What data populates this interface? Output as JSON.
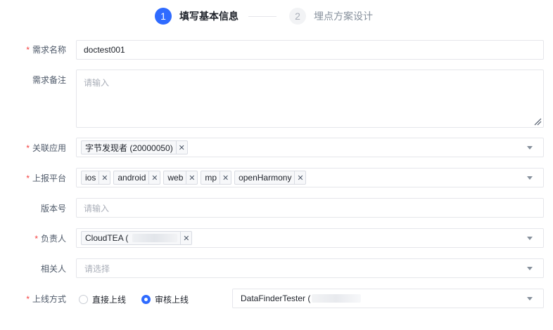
{
  "steps": [
    {
      "number": "1",
      "title": "填写基本信息",
      "state": "active"
    },
    {
      "number": "2",
      "title": "埋点方案设计",
      "state": "inactive"
    }
  ],
  "form": {
    "demand_name": {
      "label": "需求名称",
      "required": true,
      "value": "doctest001"
    },
    "demand_note": {
      "label": "需求备注",
      "required": false,
      "placeholder": "请输入"
    },
    "related_app": {
      "label": "关联应用",
      "required": true,
      "tags": [
        "字节发现者 (20000050)"
      ]
    },
    "platform": {
      "label": "上报平台",
      "required": true,
      "tags": [
        "ios",
        "android",
        "web",
        "mp",
        "openHarmony"
      ]
    },
    "version": {
      "label": "版本号",
      "required": false,
      "placeholder": "请输入"
    },
    "owner": {
      "label": "负责人",
      "required": true,
      "tags": [
        "CloudTEA ("
      ]
    },
    "related_people": {
      "label": "相关人",
      "required": false,
      "placeholder": "请选择"
    },
    "launch_method": {
      "label": "上线方式",
      "required": true,
      "options": [
        {
          "label": "直接上线",
          "checked": false
        },
        {
          "label": "审核上线",
          "checked": true
        }
      ],
      "reviewer": "DataFinderTester ("
    }
  },
  "icons": {
    "tag_close": "close-icon",
    "dropdown": "chevron-down-icon",
    "resize": "resize-handle-icon"
  },
  "colors": {
    "accent": "#2f6bff",
    "required": "#f53f3f",
    "border": "#e5e6eb",
    "placeholder": "#a9aeb8"
  }
}
